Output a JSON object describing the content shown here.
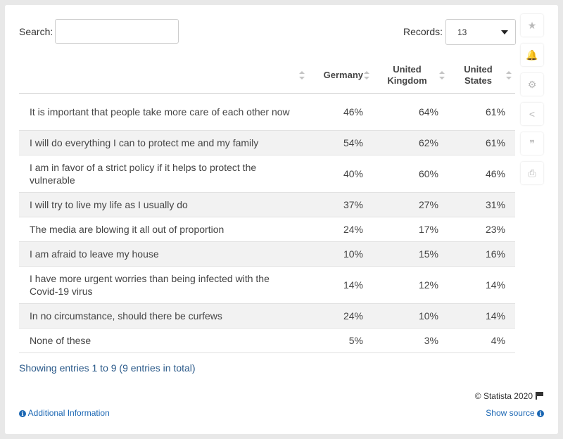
{
  "search": {
    "label": "Search:",
    "value": ""
  },
  "records": {
    "label": "Records:",
    "value": "13"
  },
  "chart_data": {
    "type": "table",
    "columns": [
      "",
      "Germany",
      "United Kingdom",
      "United States"
    ],
    "rows": [
      {
        "label": "It is important that people take more care of each other now",
        "values": [
          "46%",
          "64%",
          "61%"
        ]
      },
      {
        "label": "I will do everything I can to protect me and my family",
        "values": [
          "54%",
          "62%",
          "61%"
        ]
      },
      {
        "label": "I am in favor of a strict policy if it helps to protect the vulnerable",
        "values": [
          "40%",
          "60%",
          "46%"
        ]
      },
      {
        "label": "I will try to live my life as I usually do",
        "values": [
          "37%",
          "27%",
          "31%"
        ]
      },
      {
        "label": "The media are blowing it all out of proportion",
        "values": [
          "24%",
          "17%",
          "23%"
        ]
      },
      {
        "label": "I am afraid to leave my house",
        "values": [
          "10%",
          "15%",
          "16%"
        ]
      },
      {
        "label": "I have more urgent worries than being infected with the Covid-19 virus",
        "values": [
          "14%",
          "12%",
          "14%"
        ]
      },
      {
        "label": "In no circumstance, should there be curfews",
        "values": [
          "24%",
          "10%",
          "14%"
        ]
      },
      {
        "label": "None of these",
        "values": [
          "5%",
          "3%",
          "4%"
        ]
      }
    ]
  },
  "footer": {
    "summary": "Showing entries 1 to 9 (9 entries in total)",
    "copyright": "© Statista 2020",
    "additional_info": "Additional Information",
    "show_source": "Show source"
  },
  "toolbar": {
    "star_icon": "★",
    "bell_icon": "🔔",
    "gear_icon": "⚙",
    "share_icon": "<",
    "quote_icon": "❞",
    "print_icon": "⎙"
  },
  "colors": {
    "row_alt": "#f2f2f2",
    "link": "#1a66b3",
    "background": "#e8e8e8"
  }
}
